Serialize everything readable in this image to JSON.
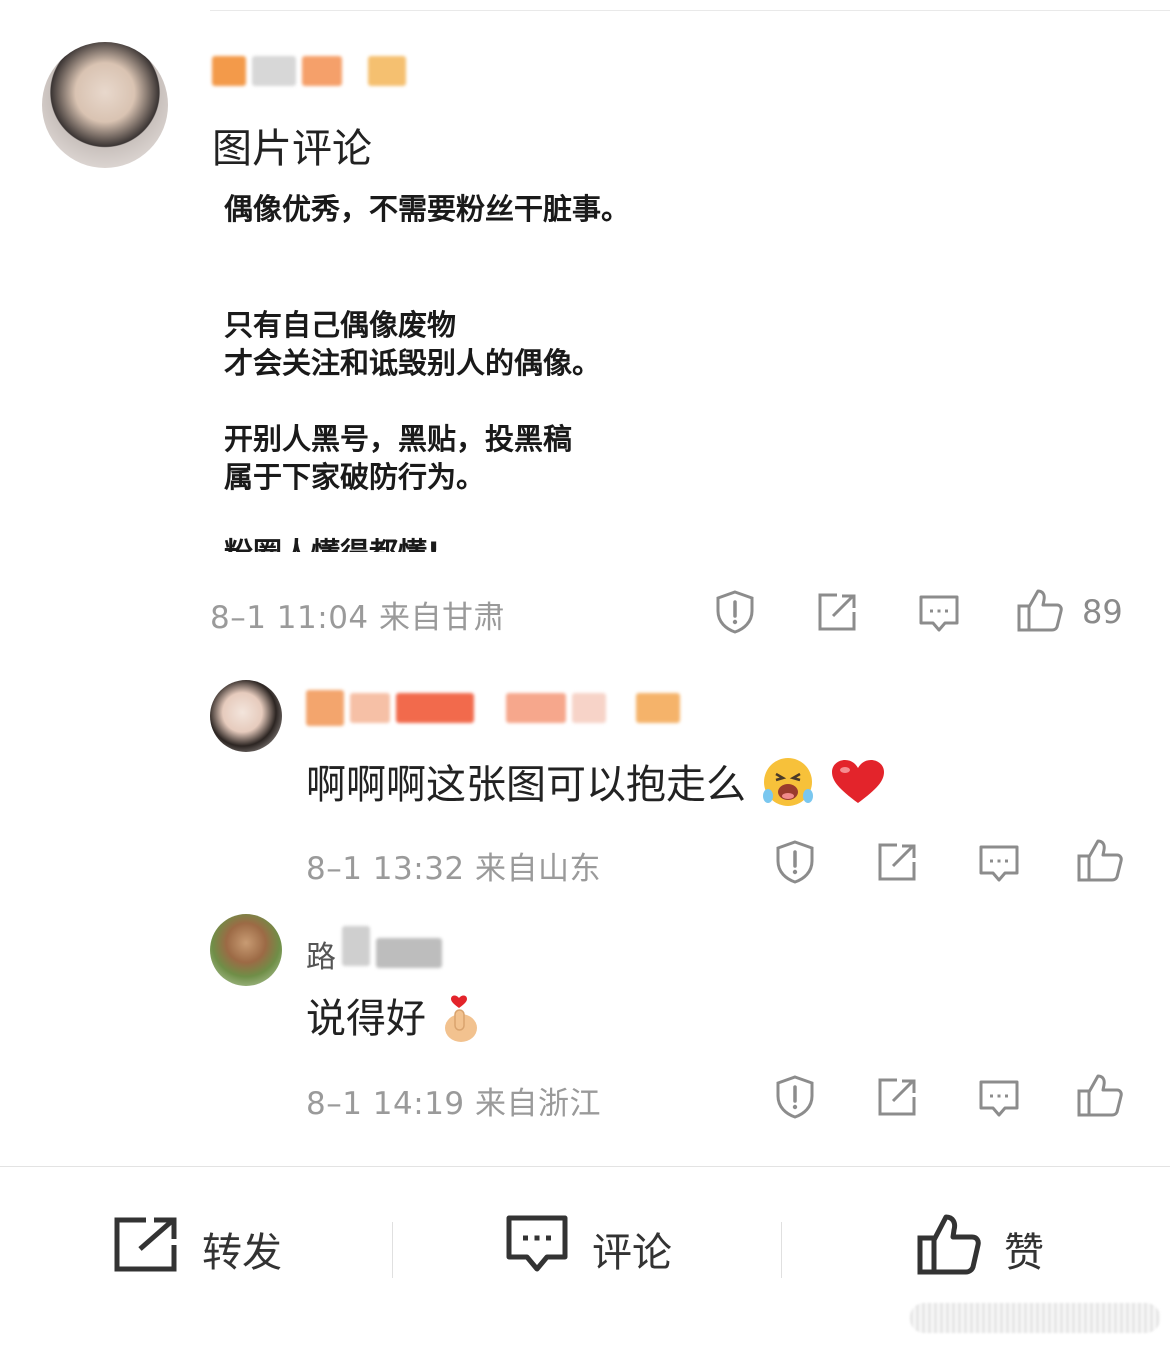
{
  "post": {
    "type_label": "图片评论",
    "image_lines": [
      "偶像优秀，不需要粉丝干脏事。",
      "只有自己偶像废物",
      "才会关注和诋毁别人的偶像。",
      "开别人黑号，黑贴，投黑稿",
      "属于下家破防行为。",
      "粉圈人懂得都懂!"
    ],
    "meta": "8–1 11:04  来自甘肃",
    "like_count": "89"
  },
  "comments": [
    {
      "text": "啊啊啊这张图可以抱走么",
      "emojis": [
        "crying-laughing-emoji",
        "red-heart-emoji"
      ],
      "meta": "8–1 13:32  来自山东"
    },
    {
      "name_partial": "路",
      "text": "说得好",
      "emojis": [
        "finger-heart-emoji"
      ],
      "meta": "8–1 14:19  来自浙江"
    }
  ],
  "bottom_bar": {
    "repost_label": "转发",
    "comment_label": "评论",
    "like_label": "赞"
  },
  "colors": {
    "meta_gray": "#9a9a9a",
    "username_orange": "#f08a3a",
    "link_blue": "#4a7bc4"
  }
}
